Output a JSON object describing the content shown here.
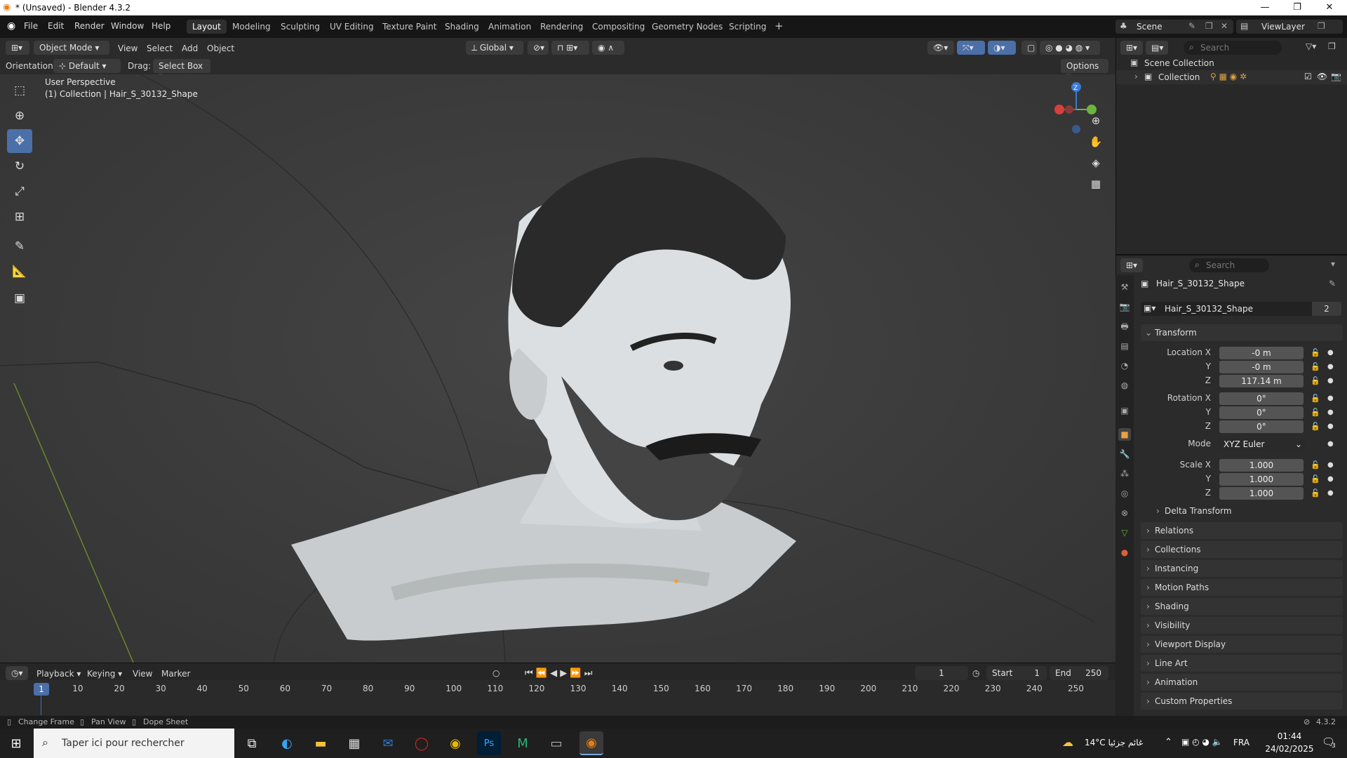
{
  "window": {
    "title": "* (Unsaved) - Blender 4.3.2"
  },
  "menu": [
    "File",
    "Edit",
    "Render",
    "Window",
    "Help"
  ],
  "workspaces": [
    "Layout",
    "Modeling",
    "Sculpting",
    "UV Editing",
    "Texture Paint",
    "Shading",
    "Animation",
    "Rendering",
    "Compositing",
    "Geometry Nodes",
    "Scripting"
  ],
  "scene": {
    "label": "Scene",
    "view_layer": "ViewLayer"
  },
  "header": {
    "mode": "Object Mode",
    "view": "View",
    "select": "Select",
    "add": "Add",
    "object": "Object",
    "transform": "Global",
    "options": "Options"
  },
  "header2": {
    "orientation_label": "Orientation:",
    "orientation": "Default",
    "drag_label": "Drag:",
    "drag": "Select Box"
  },
  "viewport": {
    "perspective": "User Perspective",
    "context": "(1) Collection | Hair_S_30132_Shape"
  },
  "outliner": {
    "search_placeholder": "Search",
    "scene_collection": "Scene Collection",
    "collection": "Collection"
  },
  "properties": {
    "search_placeholder": "Search",
    "object_name": "Hair_S_30132_Shape",
    "data_name": "Hair_S_30132_Shape",
    "users": "2",
    "transform_label": "Transform",
    "location_label": "Location X",
    "loc_x": "-0 m",
    "loc_y": "-0 m",
    "loc_z": "117.14 m",
    "rotation_label": "Rotation X",
    "rot_x": "0°",
    "rot_y": "0°",
    "rot_z": "0°",
    "mode_label": "Mode",
    "mode": "XYZ Euler",
    "scale_label": "Scale X",
    "scale_x": "1.000",
    "scale_y": "1.000",
    "scale_z": "1.000",
    "y_label": "Y",
    "z_label": "Z",
    "delta": "Delta Transform",
    "panels": [
      "Relations",
      "Collections",
      "Instancing",
      "Motion Paths",
      "Shading",
      "Visibility",
      "Viewport Display",
      "Line Art",
      "Animation",
      "Custom Properties"
    ]
  },
  "timeline": {
    "playback": "Playback",
    "keying": "Keying",
    "view": "View",
    "marker": "Marker",
    "current_frame": "1",
    "start_label": "Start",
    "start": "1",
    "end_label": "End",
    "end": "250",
    "ticks": [
      "10",
      "20",
      "30",
      "40",
      "50",
      "60",
      "70",
      "80",
      "90",
      "100",
      "110",
      "120",
      "130",
      "140",
      "150",
      "160",
      "170",
      "180",
      "190",
      "200",
      "210",
      "220",
      "230",
      "240",
      "250"
    ],
    "playhead": "1"
  },
  "status": {
    "change_frame": "Change Frame",
    "pan_view": "Pan View",
    "dope_sheet": "Dope Sheet",
    "version": "4.3.2"
  },
  "taskbar": {
    "search_placeholder": "Taper ici pour rechercher",
    "weather": "14°C غائم جزئيا",
    "lang": "FRA",
    "time": "01:44",
    "date": "24/02/2025",
    "notif": "3"
  }
}
